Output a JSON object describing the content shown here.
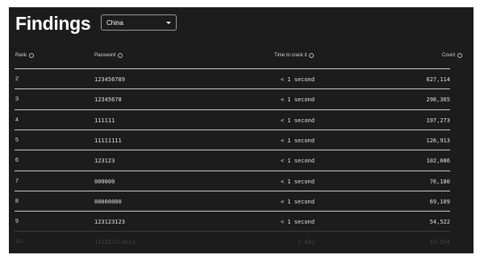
{
  "page": {
    "title": "Findings"
  },
  "country_select": {
    "value": "China"
  },
  "columns": {
    "rank": "Rank",
    "password": "Password",
    "time": "Time to crack it",
    "count": "Count"
  },
  "rows": [
    {
      "rank": "2",
      "password": "123456789",
      "time": "< 1 second",
      "count": "627,114"
    },
    {
      "rank": "3",
      "password": "12345678",
      "time": "< 1 second",
      "count": "296,365"
    },
    {
      "rank": "4",
      "password": "111111",
      "time": "< 1 second",
      "count": "197,273"
    },
    {
      "rank": "5",
      "password": "11111111",
      "time": "< 1 second",
      "count": "126,913"
    },
    {
      "rank": "6",
      "password": "123123",
      "time": "< 1 second",
      "count": "102,686"
    },
    {
      "rank": "7",
      "password": "000000",
      "time": "< 1 second",
      "count": "76,180"
    },
    {
      "rank": "8",
      "password": "00000000",
      "time": "< 1 second",
      "count": "69,109"
    },
    {
      "rank": "9",
      "password": "123123123",
      "time": "< 1 second",
      "count": "54,522"
    },
    {
      "rank": "10",
      "password": "111222tianya",
      "time": "1 day",
      "count": "43,554"
    }
  ]
}
